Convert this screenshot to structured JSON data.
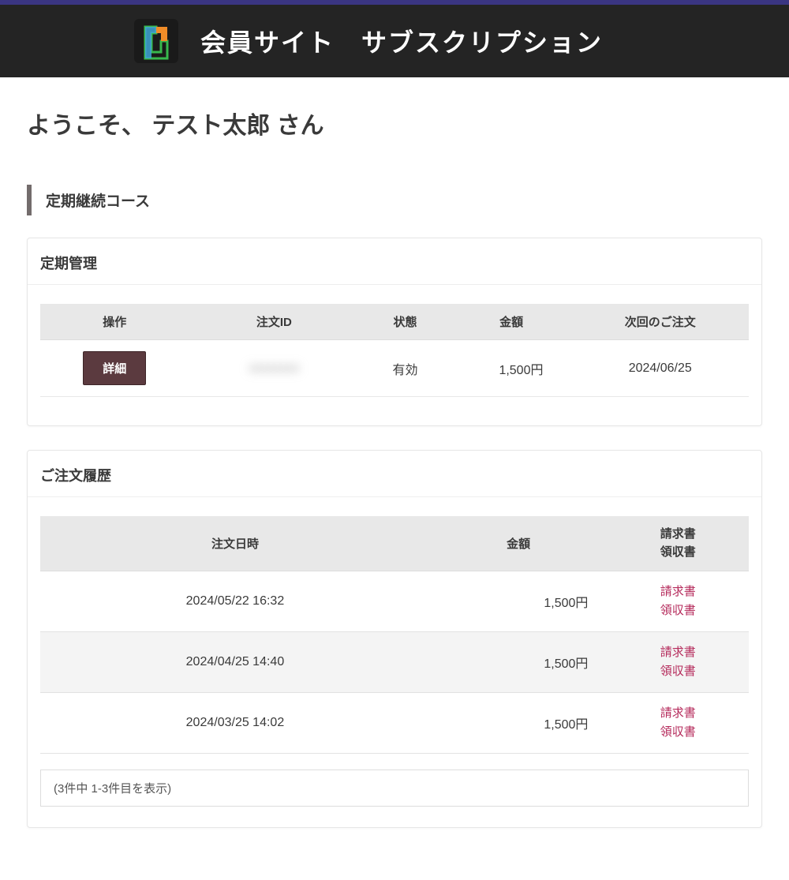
{
  "header": {
    "title": "会員サイト　サブスクリプション"
  },
  "welcome": "ようこそ、 テスト太郎 さん",
  "section_heading": "定期継続コース",
  "management": {
    "card_title": "定期管理",
    "headers": {
      "action": "操作",
      "order_id": "注文ID",
      "status": "状態",
      "amount": "金額",
      "next_order": "次回のご注文"
    },
    "row": {
      "detail_label": "詳細",
      "order_id": "xxxxxxxx",
      "status": "有効",
      "amount": "1,500円",
      "next_order": "2024/06/25"
    }
  },
  "history": {
    "card_title": "ご注文履歴",
    "headers": {
      "order_date": "注文日時",
      "amount": "金額",
      "invoice": "請求書",
      "receipt": "領収書"
    },
    "rows": [
      {
        "date": "2024/05/22 16:32",
        "amount": "1,500円",
        "invoice": "請求書",
        "receipt": "領収書"
      },
      {
        "date": "2024/04/25 14:40",
        "amount": "1,500円",
        "invoice": "請求書",
        "receipt": "領収書"
      },
      {
        "date": "2024/03/25 14:02",
        "amount": "1,500円",
        "invoice": "請求書",
        "receipt": "領収書"
      }
    ],
    "pagination": "(3件中 1-3件目を表示)"
  }
}
